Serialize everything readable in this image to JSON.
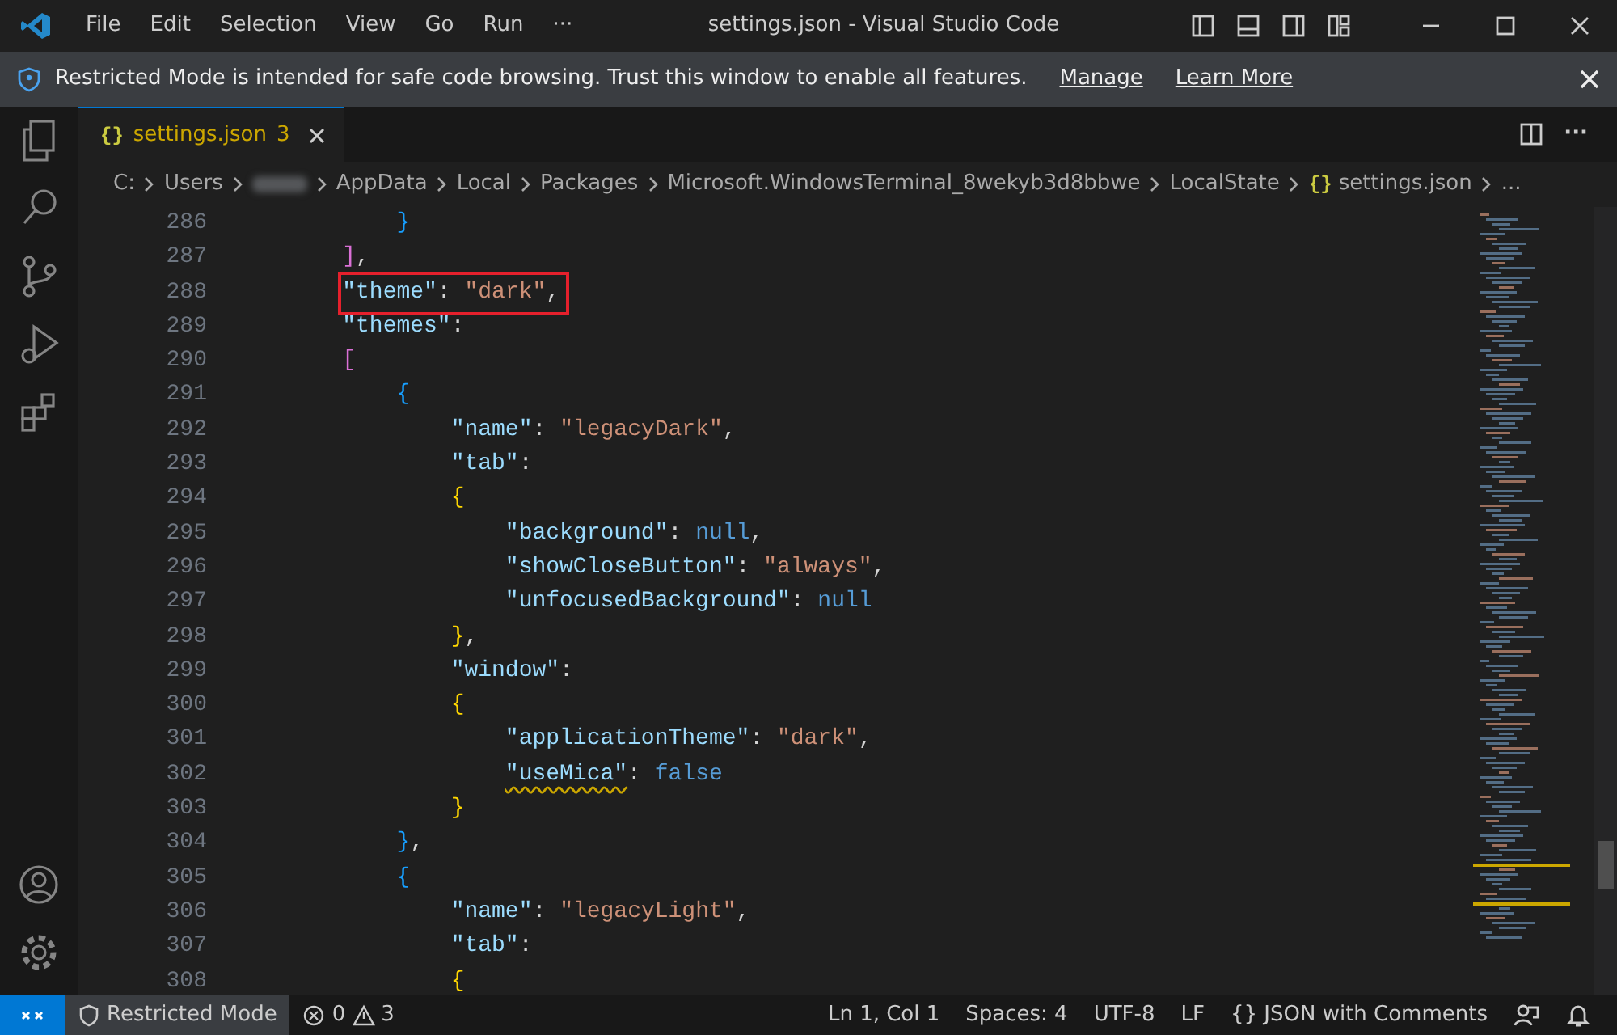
{
  "window": {
    "title": "settings.json - Visual Studio Code"
  },
  "menu": [
    "File",
    "Edit",
    "Selection",
    "View",
    "Go",
    "Run",
    "···"
  ],
  "banner": {
    "text": "Restricted Mode is intended for safe code browsing. Trust this window to enable all features.",
    "links": [
      "Manage",
      "Learn More"
    ]
  },
  "tab": {
    "icon_text": "{}",
    "label": "settings.json",
    "count": "3",
    "selected": true
  },
  "tab_actions": {
    "more": "···"
  },
  "breadcrumb": [
    {
      "kind": "text",
      "text": "C:"
    },
    {
      "kind": "text",
      "text": "Users"
    },
    {
      "kind": "redacted"
    },
    {
      "kind": "text",
      "text": "AppData"
    },
    {
      "kind": "text",
      "text": "Local"
    },
    {
      "kind": "text",
      "text": "Packages"
    },
    {
      "kind": "text",
      "text": "Microsoft.WindowsTerminal_8wekyb3d8bbwe"
    },
    {
      "kind": "text",
      "text": "LocalState"
    },
    {
      "kind": "file",
      "icon_text": "{}",
      "text": "settings.json"
    },
    {
      "kind": "text",
      "text": "..."
    }
  ],
  "lines": [
    {
      "number": "286",
      "highlighted": false,
      "warning": false,
      "tokens": [
        {
          "kind": "bracket",
          "text": "        }",
          "color": "#179fff"
        }
      ]
    },
    {
      "number": "287",
      "highlighted": false,
      "warning": false,
      "tokens": [
        {
          "kind": "bracket",
          "text": "    ]",
          "color": "#da70d6"
        },
        {
          "kind": "punct",
          "text": ","
        }
      ]
    },
    {
      "number": "288",
      "highlighted": true,
      "warning": false,
      "tokens": [
        {
          "kind": "key",
          "text": "    \"theme\""
        },
        {
          "kind": "punct",
          "text": ": "
        },
        {
          "kind": "string",
          "text": "\"dark\""
        },
        {
          "kind": "punct",
          "text": ","
        }
      ]
    },
    {
      "number": "289",
      "highlighted": false,
      "warning": false,
      "tokens": [
        {
          "kind": "key",
          "text": "    \"themes\""
        },
        {
          "kind": "punct",
          "text": ":"
        }
      ]
    },
    {
      "number": "290",
      "highlighted": false,
      "warning": false,
      "tokens": [
        {
          "kind": "bracket",
          "text": "    [",
          "color": "#da70d6"
        }
      ]
    },
    {
      "number": "291",
      "highlighted": false,
      "warning": false,
      "tokens": [
        {
          "kind": "bracket",
          "text": "        {",
          "color": "#179fff"
        }
      ]
    },
    {
      "number": "292",
      "highlighted": false,
      "warning": false,
      "tokens": [
        {
          "kind": "key",
          "text": "            \"name\""
        },
        {
          "kind": "punct",
          "text": ": "
        },
        {
          "kind": "string",
          "text": "\"legacyDark\""
        },
        {
          "kind": "punct",
          "text": ","
        }
      ]
    },
    {
      "number": "293",
      "highlighted": false,
      "warning": false,
      "tokens": [
        {
          "kind": "key",
          "text": "            \"tab\""
        },
        {
          "kind": "punct",
          "text": ":"
        }
      ]
    },
    {
      "number": "294",
      "highlighted": false,
      "warning": false,
      "tokens": [
        {
          "kind": "bracket",
          "text": "            {",
          "color": "#ffd700"
        }
      ]
    },
    {
      "number": "295",
      "highlighted": false,
      "warning": false,
      "tokens": [
        {
          "kind": "key",
          "text": "                \"background\""
        },
        {
          "kind": "punct",
          "text": ": "
        },
        {
          "kind": "keyword",
          "text": "null"
        },
        {
          "kind": "punct",
          "text": ","
        }
      ]
    },
    {
      "number": "296",
      "highlighted": false,
      "warning": false,
      "tokens": [
        {
          "kind": "key",
          "text": "                \"showCloseButton\""
        },
        {
          "kind": "punct",
          "text": ": "
        },
        {
          "kind": "string",
          "text": "\"always\""
        },
        {
          "kind": "punct",
          "text": ","
        }
      ]
    },
    {
      "number": "297",
      "highlighted": false,
      "warning": false,
      "tokens": [
        {
          "kind": "key",
          "text": "                \"unfocusedBackground\""
        },
        {
          "kind": "punct",
          "text": ": "
        },
        {
          "kind": "keyword",
          "text": "null"
        }
      ]
    },
    {
      "number": "298",
      "highlighted": false,
      "warning": false,
      "tokens": [
        {
          "kind": "bracket",
          "text": "            }",
          "color": "#ffd700"
        },
        {
          "kind": "punct",
          "text": ","
        }
      ]
    },
    {
      "number": "299",
      "highlighted": false,
      "warning": false,
      "tokens": [
        {
          "kind": "key",
          "text": "            \"window\""
        },
        {
          "kind": "punct",
          "text": ":"
        }
      ]
    },
    {
      "number": "300",
      "highlighted": false,
      "warning": false,
      "tokens": [
        {
          "kind": "bracket",
          "text": "            {",
          "color": "#ffd700"
        }
      ]
    },
    {
      "number": "301",
      "highlighted": false,
      "warning": false,
      "tokens": [
        {
          "kind": "key",
          "text": "                \"applicationTheme\""
        },
        {
          "kind": "punct",
          "text": ": "
        },
        {
          "kind": "string",
          "text": "\"dark\""
        },
        {
          "kind": "punct",
          "text": ","
        }
      ]
    },
    {
      "number": "302",
      "highlighted": false,
      "warning": true,
      "tokens": [
        {
          "kind": "key",
          "text": "                \"useMica\""
        },
        {
          "kind": "punct",
          "text": ": "
        },
        {
          "kind": "keyword",
          "text": "false"
        }
      ]
    },
    {
      "number": "303",
      "highlighted": false,
      "warning": false,
      "tokens": [
        {
          "kind": "bracket",
          "text": "            }",
          "color": "#ffd700"
        }
      ]
    },
    {
      "number": "304",
      "highlighted": false,
      "warning": false,
      "tokens": [
        {
          "kind": "bracket",
          "text": "        }",
          "color": "#179fff"
        },
        {
          "kind": "punct",
          "text": ","
        }
      ]
    },
    {
      "number": "305",
      "highlighted": false,
      "warning": false,
      "tokens": [
        {
          "kind": "bracket",
          "text": "        {",
          "color": "#179fff"
        }
      ]
    },
    {
      "number": "306",
      "highlighted": false,
      "warning": false,
      "tokens": [
        {
          "kind": "key",
          "text": "            \"name\""
        },
        {
          "kind": "punct",
          "text": ": "
        },
        {
          "kind": "string",
          "text": "\"legacyLight\""
        },
        {
          "kind": "punct",
          "text": ","
        }
      ]
    },
    {
      "number": "307",
      "highlighted": false,
      "warning": false,
      "tokens": [
        {
          "kind": "key",
          "text": "            \"tab\""
        },
        {
          "kind": "punct",
          "text": ":"
        }
      ]
    },
    {
      "number": "308",
      "highlighted": false,
      "warning": false,
      "tokens": [
        {
          "kind": "bracket",
          "text": "            {",
          "color": "#ffd700"
        }
      ]
    }
  ],
  "status_bar": {
    "restricted": "Restricted Mode",
    "errors": "0",
    "warnings": "3",
    "right": [
      {
        "kind": "text",
        "text": "Ln 1, Col 1"
      },
      {
        "kind": "text",
        "text": "Spaces: 4"
      },
      {
        "kind": "text",
        "text": "UTF-8"
      },
      {
        "kind": "text",
        "text": "LF"
      },
      {
        "kind": "language",
        "icon_text": "{}",
        "text": "JSON with Comments"
      }
    ]
  }
}
